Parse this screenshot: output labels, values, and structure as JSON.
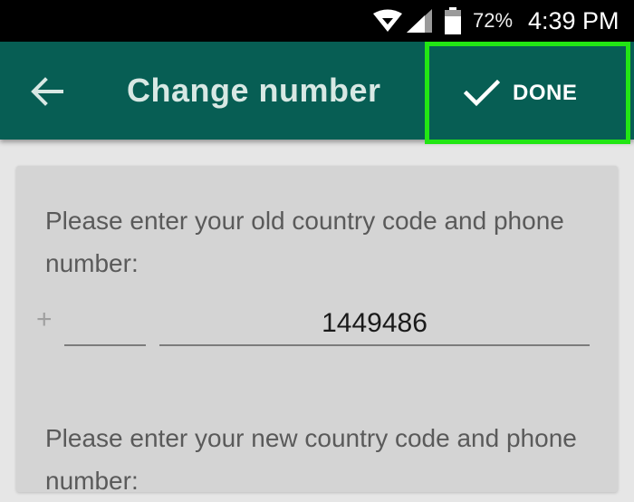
{
  "status_bar": {
    "battery_percent": "72%",
    "time": "4:39 PM",
    "icons": [
      "wifi-icon",
      "signal-icon",
      "battery-icon"
    ]
  },
  "app_bar": {
    "back_icon": "arrow-left-icon",
    "title": "Change number",
    "done_label": "DONE",
    "done_icon": "check-icon"
  },
  "form": {
    "old_prompt": "Please enter your old country code and phone number:",
    "plus_sign": "+",
    "old_country_code": "",
    "old_phone_number": "1449486",
    "new_prompt": "Please enter your new country code and phone number:"
  },
  "colors": {
    "status_bar": "#000000",
    "app_bar": "#075e54",
    "highlight": "#22e614",
    "background": "#e6e6e6",
    "card": "#d4d4d4"
  }
}
